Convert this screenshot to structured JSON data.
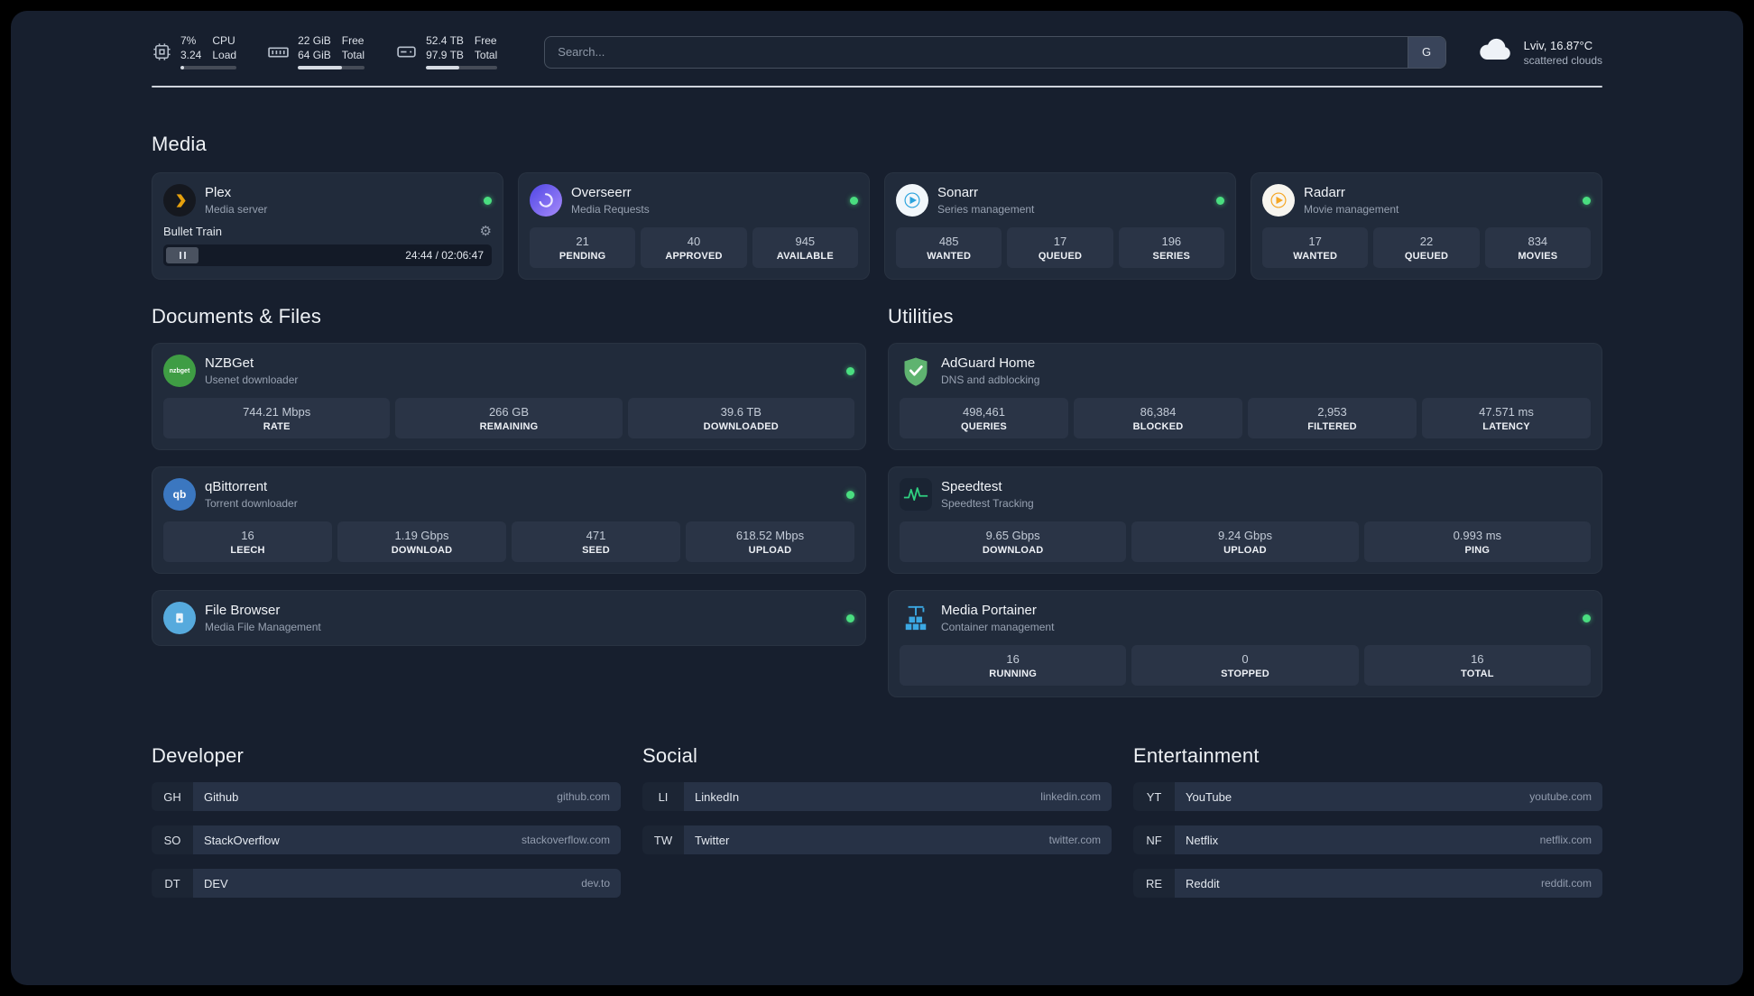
{
  "topbar": {
    "resources": [
      {
        "icon": "cpu-icon",
        "values": [
          "7%",
          "3.24"
        ],
        "labels": [
          "CPU",
          "Load"
        ],
        "used_percent": 7
      },
      {
        "icon": "memory-icon",
        "values": [
          "22 GiB",
          "64 GiB"
        ],
        "labels": [
          "Free",
          "Total"
        ],
        "used_percent": 66
      },
      {
        "icon": "disk-icon",
        "values": [
          "52.4 TB",
          "97.9 TB"
        ],
        "labels": [
          "Free",
          "Total"
        ],
        "used_percent": 46
      }
    ],
    "search": {
      "placeholder": "Search...",
      "provider_button": "G"
    },
    "weather": {
      "icon": "cloud-icon",
      "location": "Lviv, 16.87°C",
      "condition": "scattered clouds"
    }
  },
  "media": {
    "title": "Media",
    "plex": {
      "icon": "plex-icon",
      "name": "Plex",
      "subtitle": "Media server",
      "now_playing": {
        "title": "Bullet Train",
        "time": "24:44 / 02:06:47"
      }
    },
    "overseerr": {
      "icon": "overseerr-icon",
      "name": "Overseerr",
      "subtitle": "Media Requests",
      "stats": [
        {
          "value": "21",
          "label": "PENDING"
        },
        {
          "value": "40",
          "label": "APPROVED"
        },
        {
          "value": "945",
          "label": "AVAILABLE"
        }
      ]
    },
    "sonarr": {
      "icon": "sonarr-icon",
      "name": "Sonarr",
      "subtitle": "Series management",
      "stats": [
        {
          "value": "485",
          "label": "WANTED"
        },
        {
          "value": "17",
          "label": "QUEUED"
        },
        {
          "value": "196",
          "label": "SERIES"
        }
      ]
    },
    "radarr": {
      "icon": "radarr-icon",
      "name": "Radarr",
      "subtitle": "Movie management",
      "stats": [
        {
          "value": "17",
          "label": "WANTED"
        },
        {
          "value": "22",
          "label": "QUEUED"
        },
        {
          "value": "834",
          "label": "MOVIES"
        }
      ]
    }
  },
  "documents": {
    "title": "Documents & Files",
    "nzbget": {
      "icon": "nzbget-icon",
      "name": "NZBGet",
      "subtitle": "Usenet downloader",
      "stats": [
        {
          "value": "744.21 Mbps",
          "label": "RATE"
        },
        {
          "value": "266 GB",
          "label": "REMAINING"
        },
        {
          "value": "39.6 TB",
          "label": "DOWNLOADED"
        }
      ]
    },
    "qbittorrent": {
      "icon": "qbittorrent-icon",
      "name": "qBittorrent",
      "subtitle": "Torrent downloader",
      "stats": [
        {
          "value": "16",
          "label": "LEECH"
        },
        {
          "value": "1.19 Gbps",
          "label": "DOWNLOAD"
        },
        {
          "value": "471",
          "label": "SEED"
        },
        {
          "value": "618.52 Mbps",
          "label": "UPLOAD"
        }
      ]
    },
    "filebrowser": {
      "icon": "filebrowser-icon",
      "name": "File Browser",
      "subtitle": "Media File Management"
    }
  },
  "utilities": {
    "title": "Utilities",
    "adguard": {
      "icon": "adguard-icon",
      "name": "AdGuard Home",
      "subtitle": "DNS and adblocking",
      "stats": [
        {
          "value": "498,461",
          "label": "QUERIES"
        },
        {
          "value": "86,384",
          "label": "BLOCKED"
        },
        {
          "value": "2,953",
          "label": "FILTERED"
        },
        {
          "value": "47.571 ms",
          "label": "LATENCY"
        }
      ]
    },
    "speedtest": {
      "icon": "speedtest-icon",
      "name": "Speedtest",
      "subtitle": "Speedtest Tracking",
      "stats": [
        {
          "value": "9.65 Gbps",
          "label": "DOWNLOAD"
        },
        {
          "value": "9.24 Gbps",
          "label": "UPLOAD"
        },
        {
          "value": "0.993 ms",
          "label": "PING"
        }
      ]
    },
    "portainer": {
      "icon": "portainer-icon",
      "name": "Media Portainer",
      "subtitle": "Container management",
      "stats": [
        {
          "value": "16",
          "label": "RUNNING"
        },
        {
          "value": "0",
          "label": "STOPPED"
        },
        {
          "value": "16",
          "label": "TOTAL"
        }
      ]
    }
  },
  "bookmarks": {
    "developer": {
      "title": "Developer",
      "items": [
        {
          "abbr": "GH",
          "name": "Github",
          "domain": "github.com"
        },
        {
          "abbr": "SO",
          "name": "StackOverflow",
          "domain": "stackoverflow.com"
        },
        {
          "abbr": "DT",
          "name": "DEV",
          "domain": "dev.to"
        }
      ]
    },
    "social": {
      "title": "Social",
      "items": [
        {
          "abbr": "LI",
          "name": "LinkedIn",
          "domain": "linkedin.com"
        },
        {
          "abbr": "TW",
          "name": "Twitter",
          "domain": "twitter.com"
        }
      ]
    },
    "entertainment": {
      "title": "Entertainment",
      "items": [
        {
          "abbr": "YT",
          "name": "YouTube",
          "domain": "youtube.com"
        },
        {
          "abbr": "NF",
          "name": "Netflix",
          "domain": "netflix.com"
        },
        {
          "abbr": "RE",
          "name": "Reddit",
          "domain": "reddit.com"
        }
      ]
    }
  },
  "colors": {
    "background": "#171f2e",
    "card": "#212b3b",
    "tile": "#2a3446",
    "status_green": "#4ade80",
    "plex_amber": "#e5a00d",
    "overseerr_purple": "#7c3aed",
    "sonarr_blue": "#2ba3dd",
    "radarr_amber": "#f5a623",
    "nzbget_green": "#3f9d44",
    "qbittorrent_blue": "#3b77c0",
    "filebrowser_blue": "#56aadd",
    "adguard_green": "#5fb370",
    "speedtest_green": "#2fd181",
    "portainer_blue": "#3ba8e3"
  }
}
